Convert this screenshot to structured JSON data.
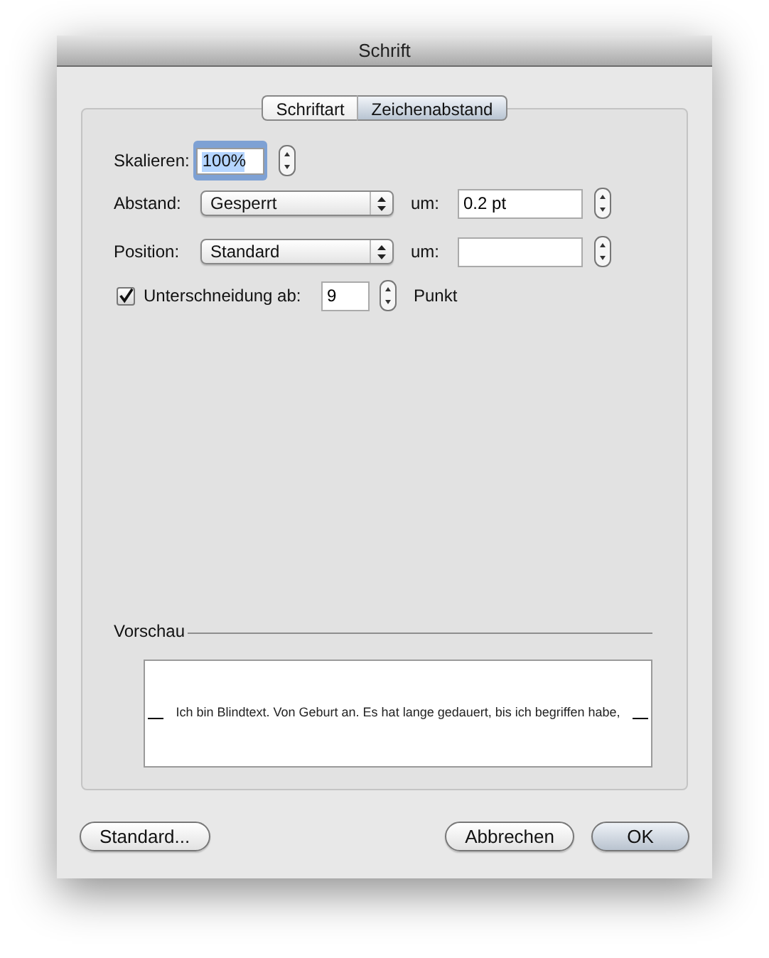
{
  "window": {
    "title": "Schrift"
  },
  "tabs": [
    {
      "label": "Schriftart",
      "selected": false
    },
    {
      "label": "Zeichenabstand",
      "selected": true
    }
  ],
  "scale": {
    "label": "Skalieren:",
    "value": "100%",
    "focused": true
  },
  "rows": [
    {
      "label": "Abstand:",
      "popup": "Gesperrt",
      "unit_label": "um:",
      "value": "0.2 pt"
    },
    {
      "label": "Position:",
      "popup": "Standard",
      "unit_label": "um:"
    }
  ],
  "kerning": {
    "label": "Unterschneidung ab:",
    "checked": true,
    "value": "9",
    "unit": "Punkt"
  },
  "preview": {
    "label": "Vorschau",
    "text": "Ich bin Blindtext. Von Geburt an. Es hat lange gedauert, bis ich begriffen habe,"
  },
  "buttons": [
    {
      "label": "Standard...",
      "default": false
    },
    {
      "label": "Abbrechen",
      "default": false
    },
    {
      "label": "OK",
      "default": true
    }
  ]
}
